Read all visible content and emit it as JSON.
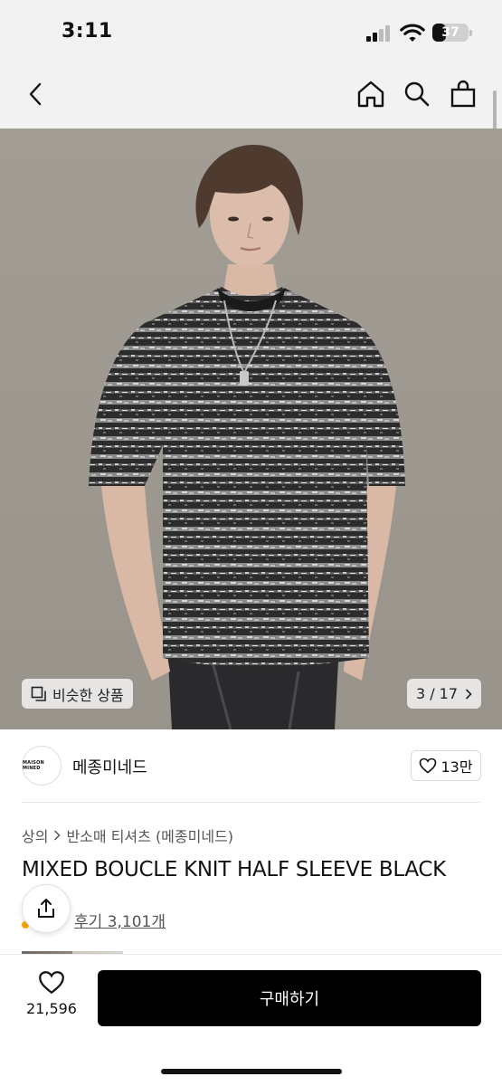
{
  "status_bar": {
    "time": "3:11",
    "battery_level": "37"
  },
  "nav": {
    "icons": [
      "back-icon",
      "home-icon",
      "search-icon",
      "bag-icon"
    ]
  },
  "gallery": {
    "similar_label": "비슷한 상품",
    "counter": "3 / 17"
  },
  "brand": {
    "logo_text": "MAISON MINED",
    "name": "메종미네드",
    "likes": "13만"
  },
  "breadcrumb": {
    "category": "상의",
    "subcategory": "반소매 티셔츠 (메종미네드)"
  },
  "product": {
    "title": "MIXED BOUCLE KNIT HALF SLEEVE BLACK",
    "reviews": "후기 3,101개"
  },
  "bottom_bar": {
    "wish_count": "21,596",
    "buy_label": "구매하기"
  },
  "colors": {
    "header_bg": "#f2f2f2",
    "buy_bg": "#000000",
    "photo_bg": "#9d9890",
    "review_star": "#f7a400"
  }
}
